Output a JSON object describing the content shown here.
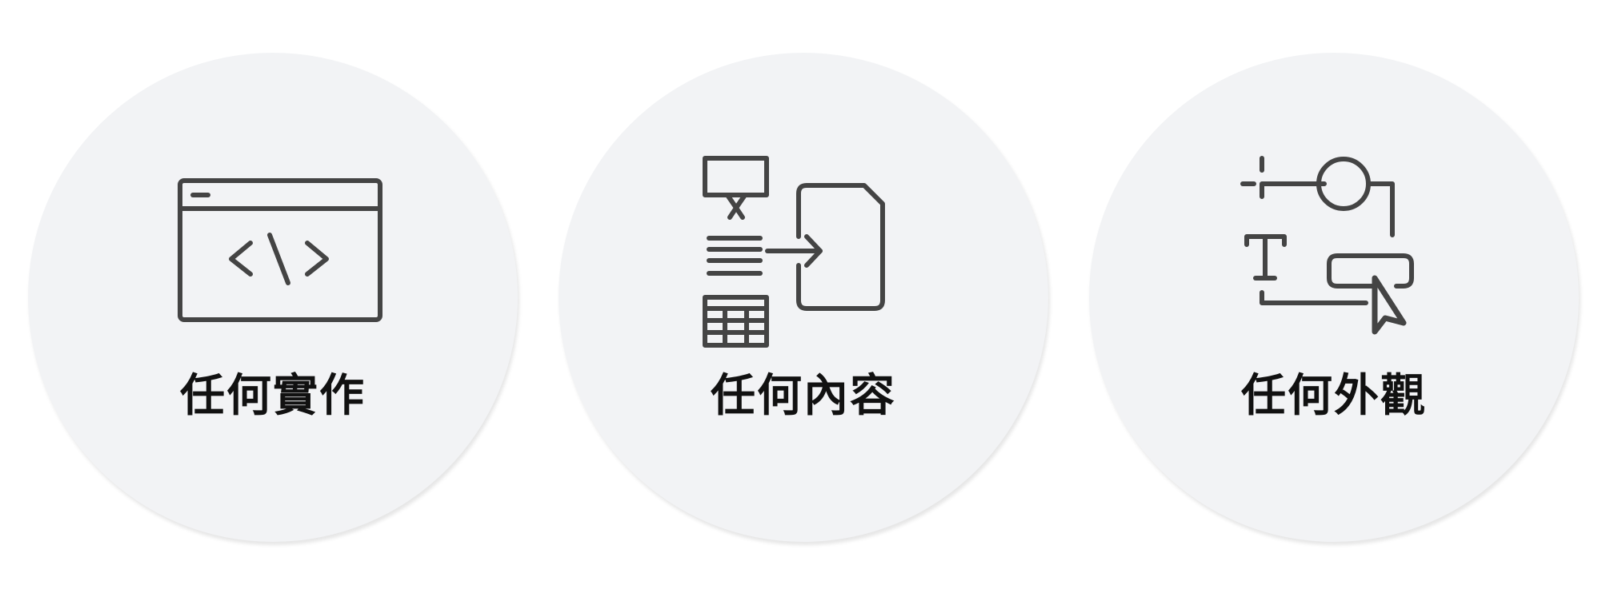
{
  "cards": [
    {
      "label": "任何實作",
      "icon": "code-window-icon"
    },
    {
      "label": "任何內容",
      "icon": "content-import-icon"
    },
    {
      "label": "任何外觀",
      "icon": "design-layout-icon"
    }
  ],
  "colors": {
    "circle_background": "#f2f3f5",
    "icon_stroke": "#444444",
    "label_text": "#111111",
    "page_background": "#ffffff"
  }
}
